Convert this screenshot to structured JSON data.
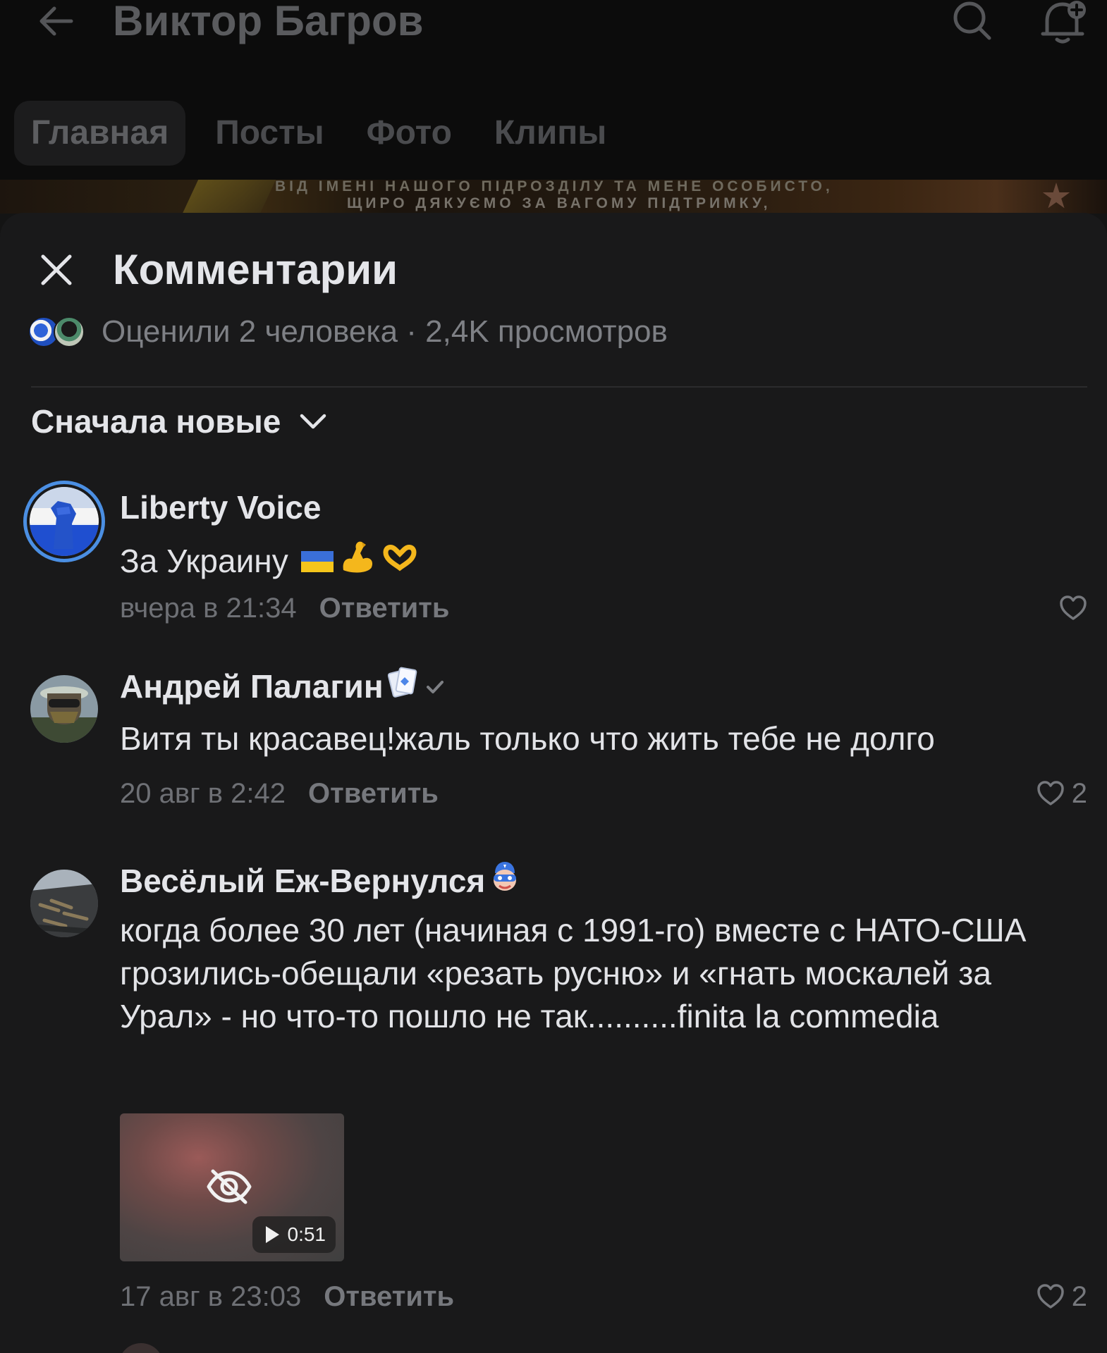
{
  "profile": {
    "name": "Виктор Багров",
    "tabs": [
      "Главная",
      "Посты",
      "Фото",
      "Клипы"
    ],
    "banner_line1": "ВІД ІМЕНІ НАШОГО ПІДРОЗДІЛУ ТА МЕНЕ ОСОБИСТО,",
    "banner_line2": "ЩИРО ДЯКУЄМО ЗА ВАГОМУ ПІДТРИМКУ,"
  },
  "sheet": {
    "title": "Комментарии",
    "stats": "Оценили 2 человека · 2,4K просмотров",
    "sort_label": "Сначала новые"
  },
  "comments": [
    {
      "author": "Liberty Voice",
      "text": "За Украину",
      "emojis": [
        "ukraine-flag",
        "flexed-biceps",
        "heart-hands"
      ],
      "time": "вчера в 21:34",
      "reply": "Ответить",
      "likes": ""
    },
    {
      "author": "Андрей Палагин",
      "badges": [
        "playing-cards",
        "verified-check"
      ],
      "text": "Витя ты красавец!жаль только что жить тебе не долго",
      "time": "20 авг в 2:42",
      "reply": "Ответить",
      "likes": "2"
    },
    {
      "author": "Весёлый Еж-Вернулся",
      "badges": [
        "masked-face"
      ],
      "text": "когда более 30 лет (начиная с 1991-го) вместе с НАТО-США грозились-обещали «резать русню» и «гнать москалей за Урал» - но что-то пошло не так..........finita la commedia",
      "video_duration": "0:51",
      "time": "17 авг в 23:03",
      "reply": "Ответить",
      "likes": "2"
    }
  ],
  "colors": {
    "sheet_bg": "#19191a",
    "text_primary": "#e4e5e9",
    "text_secondary": "#6e7075",
    "ukraine_blue": "#3a6fd8",
    "ukraine_yellow": "#f5c51b"
  }
}
